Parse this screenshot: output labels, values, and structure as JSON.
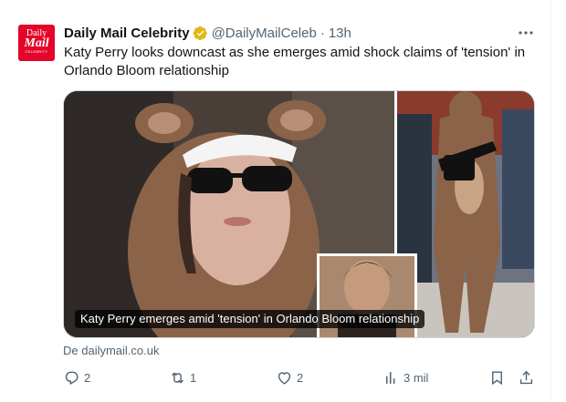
{
  "author": {
    "display_name": "Daily Mail Celebrity",
    "handle": "@DailyMailCeleb",
    "separator": "·",
    "time": "13h",
    "avatar_line1": "Daily",
    "avatar_line2": "Mail",
    "avatar_line3": "CELEBRITY"
  },
  "tweet": {
    "text": "Katy Perry looks downcast as she emerges amid shock claims of 'tension' in Orlando Bloom relationship",
    "more_label": "···"
  },
  "media": {
    "caption": "Katy Perry emerges amid 'tension' in Orlando Bloom relationship"
  },
  "card": {
    "source": "De dailymail.co.uk"
  },
  "actions": {
    "replies": "2",
    "retweets": "1",
    "likes": "2",
    "views": "3 mil"
  },
  "icons": {
    "reply": "reply-icon",
    "retweet": "retweet-icon",
    "like": "heart-icon",
    "views": "views-icon",
    "bookmark": "bookmark-icon",
    "share": "share-icon",
    "verified": "verified-badge-icon"
  },
  "colors": {
    "brand_red": "#e3062a",
    "verified_gold": "#e2b719",
    "secondary_text": "#536471",
    "primary_text": "#0f1419"
  }
}
